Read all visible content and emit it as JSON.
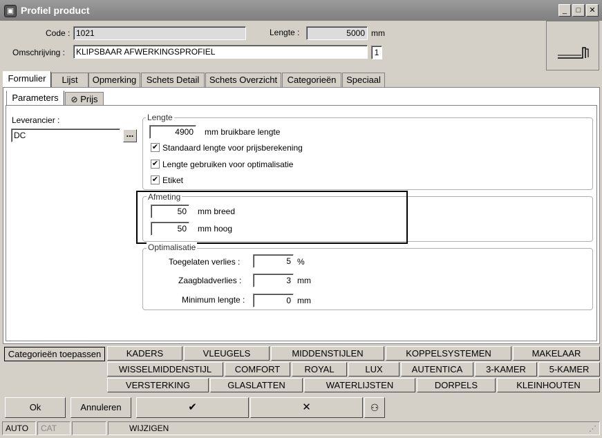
{
  "window": {
    "title": "Profiel product"
  },
  "header": {
    "code_label": "Code :",
    "code_value": "1021",
    "lengte_label": "Lengte :",
    "lengte_value": "5000",
    "lengte_unit": "mm",
    "omschrijving_label": "Omschrijving :",
    "omschrijving_value": "KLIPSBAAR AFWERKINGSPROFIEL",
    "omschrijving_count": "1"
  },
  "tabs": [
    "Formulier",
    "Lijst",
    "Opmerking",
    "Schets Detail",
    "Schets Overzicht",
    "Categorieën",
    "Speciaal"
  ],
  "subtabs": [
    "Parameters",
    "Prijs"
  ],
  "leverancier": {
    "label": "Leverancier :",
    "value": "DC",
    "browse": "..."
  },
  "lengte_group": {
    "title": "Lengte",
    "value": "4900",
    "unit": "mm bruikbare lengte",
    "checks": [
      {
        "label": "Standaard lengte voor prijsberekening",
        "checked": true
      },
      {
        "label": "Lengte gebruiken voor optimalisatie",
        "checked": true
      },
      {
        "label": "Etiket",
        "checked": true
      }
    ]
  },
  "afmeting_group": {
    "title": "Afmeting",
    "breed_value": "50",
    "breed_unit": "mm breed",
    "hoog_value": "50",
    "hoog_unit": "mm hoog"
  },
  "optimalisatie_group": {
    "title": "Optimalisatie",
    "rows": [
      {
        "label": "Toegelaten verlies :",
        "value": "5",
        "unit": "%"
      },
      {
        "label": "Zaagbladverlies :",
        "value": "3",
        "unit": "mm"
      },
      {
        "label": "Minimum lengte :",
        "value": "0",
        "unit": "mm"
      }
    ]
  },
  "categories": {
    "apply_label": "Categorieën toepassen",
    "row1": [
      "KADERS",
      "VLEUGELS",
      "MIDDENSTIJLEN",
      "KOPPELSYSTEMEN",
      "MAKELAAR"
    ],
    "row2": [
      "WISSELMIDDENSTIJL",
      "COMFORT",
      "ROYAL",
      "LUX",
      "AUTENTICA",
      "3-KAMER",
      "5-KAMER"
    ],
    "row3": [
      "VERSTERKING",
      "GLASLATTEN",
      "WATERLIJSTEN",
      "DORPELS",
      "KLEINHOUTEN"
    ]
  },
  "buttons": {
    "ok": "Ok",
    "cancel": "Annuleren",
    "confirm": "✔",
    "remove": "✕",
    "search_icon": "binoculars-icon"
  },
  "status": {
    "mode": "AUTO",
    "cat": "CAT",
    "action": "WIJZIGEN"
  }
}
